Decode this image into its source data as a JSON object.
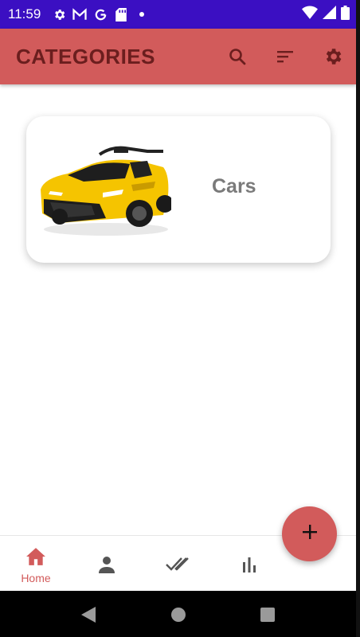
{
  "status_bar": {
    "time": "11:59",
    "left_icons": [
      "gear-icon",
      "gmail-icon",
      "google-icon",
      "sd-card-icon",
      "dot-icon"
    ],
    "right_icons": [
      "wifi-icon",
      "signal-icon",
      "battery-icon"
    ]
  },
  "app_bar": {
    "title": "CATEGORIES",
    "actions": [
      "search-icon",
      "sort-icon",
      "settings-icon"
    ],
    "color": "#d25b5b",
    "title_color": "#6b1e1e"
  },
  "categories": [
    {
      "label": "Cars",
      "image": "yellow-toy-car"
    }
  ],
  "bottom_nav": {
    "items": [
      {
        "label": "Home",
        "icon": "home-icon",
        "active": true
      },
      {
        "label": "",
        "icon": "person-icon",
        "active": false
      },
      {
        "label": "",
        "icon": "done-all-icon",
        "active": false
      },
      {
        "label": "",
        "icon": "bar-chart-icon",
        "active": false
      }
    ],
    "active_color": "#d25b5b",
    "inactive_color": "#555555"
  },
  "fab": {
    "label": "+",
    "icon": "plus-icon"
  },
  "system_nav": [
    "back-icon",
    "home-circle-icon",
    "recents-icon"
  ]
}
